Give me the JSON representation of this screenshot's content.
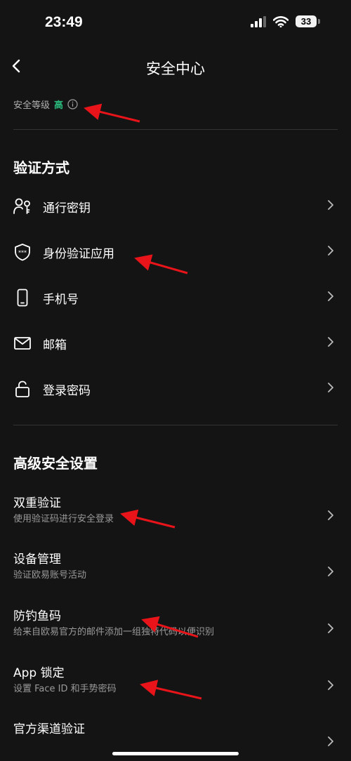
{
  "status_bar": {
    "time": "23:49",
    "battery": "33"
  },
  "nav": {
    "title": "安全中心"
  },
  "security_level": {
    "label": "安全等级",
    "value": "高"
  },
  "verification": {
    "title": "验证方式",
    "items": [
      {
        "label": "通行密钥",
        "icon": "passkey-icon"
      },
      {
        "label": "身份验证应用",
        "icon": "authenticator-shield-icon"
      },
      {
        "label": "手机号",
        "icon": "phone-icon"
      },
      {
        "label": "邮箱",
        "icon": "mail-icon"
      },
      {
        "label": "登录密码",
        "icon": "lock-icon"
      }
    ]
  },
  "advanced": {
    "title": "高级安全设置",
    "items": [
      {
        "label": "双重验证",
        "sub": "使用验证码进行安全登录"
      },
      {
        "label": "设备管理",
        "sub": "验证欧易账号活动"
      },
      {
        "label": "防钓鱼码",
        "sub": "给来自欧易官方的邮件添加一组独特代码以便识别"
      },
      {
        "label": "App 锁定",
        "sub": "设置 Face ID 和手势密码"
      },
      {
        "label": "官方渠道验证"
      }
    ]
  },
  "colors": {
    "background": "#141414",
    "accent_green": "#2bbd7e",
    "annotation_red": "#e8141a"
  }
}
